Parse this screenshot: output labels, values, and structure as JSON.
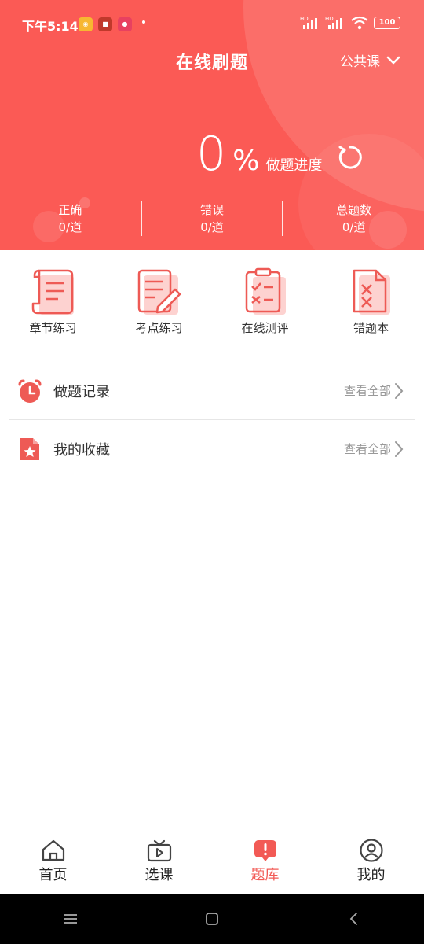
{
  "status_bar": {
    "time": "下午5:14",
    "battery": "100",
    "network_hd_1": "HD",
    "network_hd_2": "HD"
  },
  "header": {
    "title": "在线刷题",
    "subject_selector": "公共课",
    "progress_value": "0",
    "progress_unit": "%",
    "progress_label": "做题进度",
    "stats": [
      {
        "label": "正确",
        "value": "0/道"
      },
      {
        "label": "错误",
        "value": "0/道"
      },
      {
        "label": "总题数",
        "value": "0/道"
      }
    ]
  },
  "features": [
    {
      "label": "章节练习",
      "icon": "scroll-icon"
    },
    {
      "label": "考点练习",
      "icon": "notepad-pencil-icon"
    },
    {
      "label": "在线测评",
      "icon": "clipboard-check-icon"
    },
    {
      "label": "错题本",
      "icon": "wrong-book-icon"
    }
  ],
  "list": [
    {
      "title": "做题记录",
      "more": "查看全部",
      "icon": "alarm-clock-icon"
    },
    {
      "title": "我的收藏",
      "more": "查看全部",
      "icon": "star-document-icon"
    }
  ],
  "tabs": [
    {
      "label": "首页",
      "icon": "home-icon"
    },
    {
      "label": "选课",
      "icon": "tv-play-icon"
    },
    {
      "label": "题库",
      "icon": "question-bank-icon"
    },
    {
      "label": "我的",
      "icon": "user-icon"
    }
  ],
  "colors": {
    "brand": "#fb5a55",
    "accent": "#f25a55",
    "muted": "#999999"
  }
}
